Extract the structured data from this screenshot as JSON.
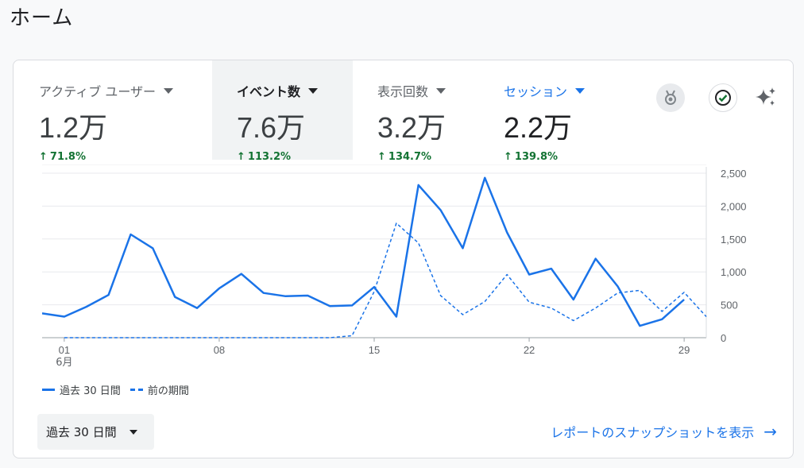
{
  "page": {
    "title": "ホーム"
  },
  "metrics": [
    {
      "label": "アクティブ ユーザー",
      "value": "1.2万",
      "change": "71.8%",
      "selected": false,
      "active": false
    },
    {
      "label": "イベント数",
      "value": "7.6万",
      "change": "113.2%",
      "selected": true,
      "active": false
    },
    {
      "label": "表示回数",
      "value": "3.2万",
      "change": "134.7%",
      "selected": false,
      "active": false
    },
    {
      "label": "セッション",
      "value": "2.2万",
      "change": "139.8%",
      "selected": false,
      "active": true
    }
  ],
  "icons": {
    "medal": "medal-icon",
    "check": "check-circle-icon",
    "sparkle": "sparkle-icon"
  },
  "colors": {
    "accent": "#1a73e8",
    "positive": "#137333"
  },
  "chart_data": {
    "type": "line",
    "x": [
      "5/31",
      "6/1",
      "6/2",
      "6/3",
      "6/4",
      "6/5",
      "6/6",
      "6/7",
      "6/8",
      "6/9",
      "6/10",
      "6/11",
      "6/12",
      "6/13",
      "6/14",
      "6/15",
      "6/16",
      "6/17",
      "6/18",
      "6/19",
      "6/20",
      "6/21",
      "6/22",
      "6/23",
      "6/24",
      "6/25",
      "6/26",
      "6/27",
      "6/28",
      "6/29",
      "6/30"
    ],
    "x_ticks": [
      {
        "at": "6/1",
        "label": "01",
        "sub": "6月"
      },
      {
        "at": "6/8",
        "label": "08",
        "sub": ""
      },
      {
        "at": "6/15",
        "label": "15",
        "sub": ""
      },
      {
        "at": "6/22",
        "label": "22",
        "sub": ""
      },
      {
        "at": "6/29",
        "label": "29",
        "sub": ""
      }
    ],
    "ylim": [
      0,
      2500
    ],
    "y_ticks": [
      0,
      500,
      1000,
      1500,
      2000,
      2500
    ],
    "y_tick_labels": [
      "0",
      "500",
      "1,000",
      "1,500",
      "2,000",
      "2,500"
    ],
    "series": [
      {
        "name": "過去 30 日間",
        "style": "solid",
        "values": [
          370,
          320,
          470,
          650,
          1570,
          1360,
          620,
          450,
          750,
          970,
          680,
          630,
          640,
          480,
          490,
          770,
          320,
          2320,
          1940,
          1360,
          2430,
          1600,
          960,
          1050,
          580,
          1200,
          780,
          180,
          280,
          580,
          null
        ]
      },
      {
        "name": "前の期間",
        "style": "dashed",
        "values": [
          null,
          0,
          0,
          0,
          0,
          0,
          0,
          0,
          0,
          0,
          0,
          0,
          0,
          0,
          30,
          700,
          1740,
          1440,
          640,
          350,
          550,
          960,
          540,
          450,
          260,
          450,
          680,
          720,
          400,
          690,
          320
        ]
      }
    ],
    "grid": true,
    "legend_position": "bottom-left"
  },
  "footer": {
    "date_range_label": "過去 30 日間",
    "report_link": "レポートのスナップショットを表示"
  }
}
